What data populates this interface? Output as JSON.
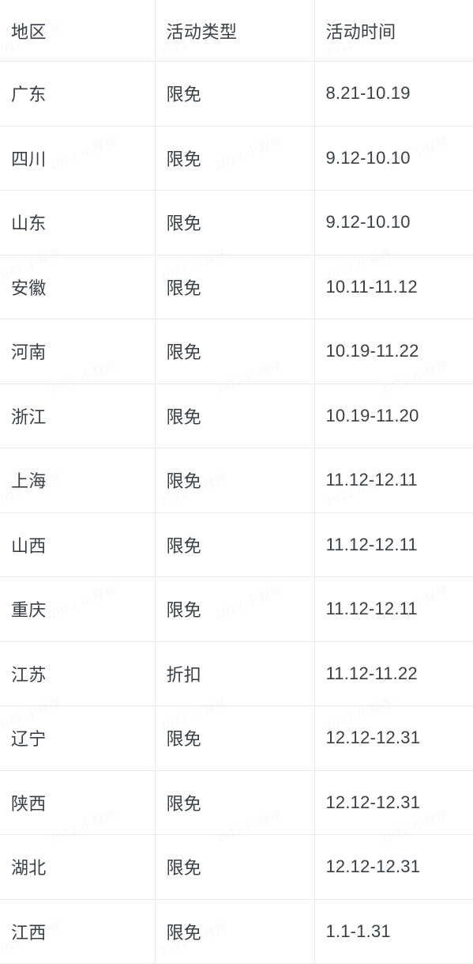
{
  "table": {
    "columns": [
      {
        "key": "region",
        "label": "地区"
      },
      {
        "key": "type",
        "label": "活动类型"
      },
      {
        "key": "time",
        "label": "活动时间"
      }
    ],
    "rows": [
      {
        "region": "广东",
        "type": "限免",
        "time": "8.21-10.19"
      },
      {
        "region": "四川",
        "type": "限免",
        "time": "9.12-10.10"
      },
      {
        "region": "山东",
        "type": "限免",
        "time": "9.12-10.10"
      },
      {
        "region": "安徽",
        "type": "限免",
        "time": "10.11-11.12"
      },
      {
        "region": "河南",
        "type": "限免",
        "time": "10.19-11.22"
      },
      {
        "region": "浙江",
        "type": "限免",
        "time": "10.19-11.20"
      },
      {
        "region": "上海",
        "type": "限免",
        "time": "11.12-12.11"
      },
      {
        "region": "山西",
        "type": "限免",
        "time": "11.12-12.11"
      },
      {
        "region": "重庆",
        "type": "限免",
        "time": "11.12-12.11"
      },
      {
        "region": "江苏",
        "type": "折扣",
        "time": "11.12-11.22"
      },
      {
        "region": "辽宁",
        "type": "限免",
        "time": "12.12-12.31"
      },
      {
        "region": "陕西",
        "type": "限免",
        "time": "12.12-12.31"
      },
      {
        "region": "湖北",
        "type": "限免",
        "time": "12.12-12.31"
      },
      {
        "region": "江西",
        "type": "限免",
        "time": "1.1-1.31"
      }
    ]
  },
  "watermark": {
    "text": "2022 小程序",
    "repeat": 26
  },
  "colors": {
    "text": "#3a3f45",
    "border": "#e8eaec",
    "background": "#ffffff"
  }
}
